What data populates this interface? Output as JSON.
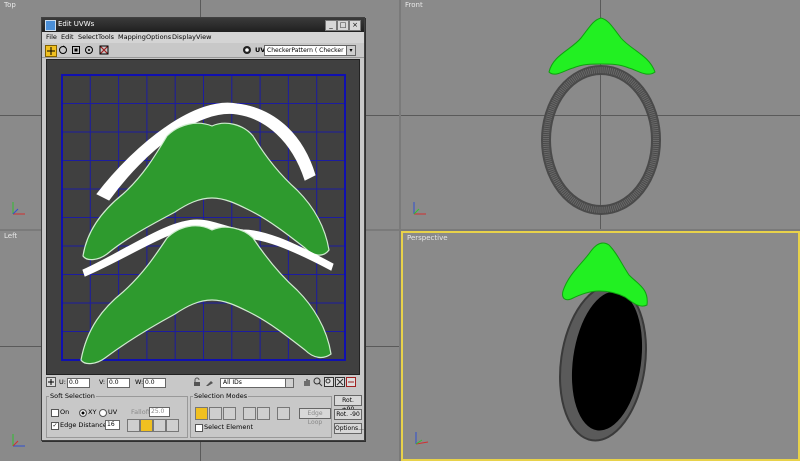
{
  "viewports": {
    "top": {
      "label": "Top"
    },
    "left": {
      "label": "Left"
    },
    "front": {
      "label": "Front"
    },
    "perspective": {
      "label": "Perspective"
    }
  },
  "uvw_window": {
    "title": "Edit UVWs",
    "menu": [
      "File",
      "Edit",
      "Select",
      "Tools",
      "Mapping",
      "Options",
      "Display",
      "View"
    ],
    "map_select": "CheckerPattern  ( Checker )",
    "uv_label": "UV",
    "bottom": {
      "u_label": "U:",
      "u_value": "0.0",
      "v_label": "V:",
      "v_value": "0.0",
      "w_label": "W:",
      "w_value": "0.0",
      "ids_select": "All IDs"
    },
    "soft_selection": {
      "title": "Soft Selection",
      "on_label": "On",
      "xy_label": "XY",
      "uv_label": "UV",
      "falloff_label": "Falloff:",
      "falloff_value": "25.0",
      "edge_distance_label": "Edge Distance",
      "edge_distance_value": "16"
    },
    "selection_modes": {
      "title": "Selection Modes",
      "edge_loop_label": "Edge Loop",
      "select_element_label": "Select Element"
    },
    "rot_plus_label": "Rot. +90",
    "rot_minus_label": "Rot. -90",
    "options_label": "Options..."
  },
  "colors": {
    "viewport_bg": "#8a8a8a",
    "uv_canvas_bg": "#404040",
    "grid_line": "#1c1ca0",
    "mesh_green": "#32c832",
    "active_border": "#e8d24a"
  }
}
